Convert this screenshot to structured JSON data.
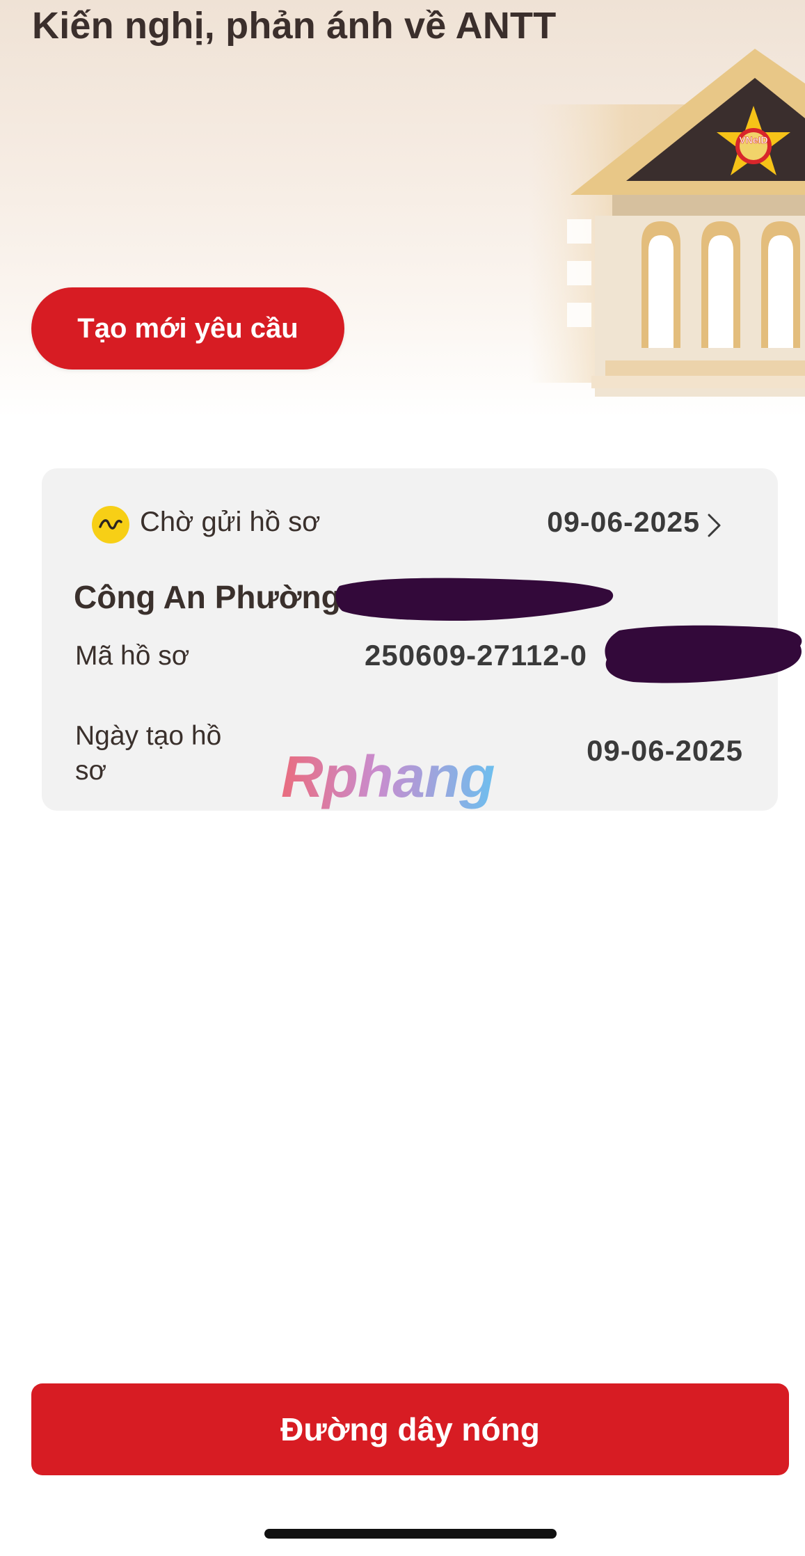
{
  "header": {
    "title": "Kiến nghị, phản ánh về ANTT",
    "emblem_text": "VNeID"
  },
  "actions": {
    "create_label": "Tạo mới yêu cầu",
    "hotline_label": "Đường dây nóng"
  },
  "request_card": {
    "status": "Chờ gửi hồ sơ",
    "status_icon": "wave-icon",
    "date": "09-06-2025",
    "office_name": "Công An Phường",
    "code_label": "Mã hồ sơ",
    "code_value": "250609-27112-0",
    "created_label": "Ngày tạo hồ sơ",
    "created_value": "09-06-2025"
  },
  "watermark": "Rphang",
  "colors": {
    "primary_red": "#d71c23",
    "status_yellow": "#f7cf16",
    "card_bg": "#f2f2f2",
    "redaction": "#33093a"
  }
}
